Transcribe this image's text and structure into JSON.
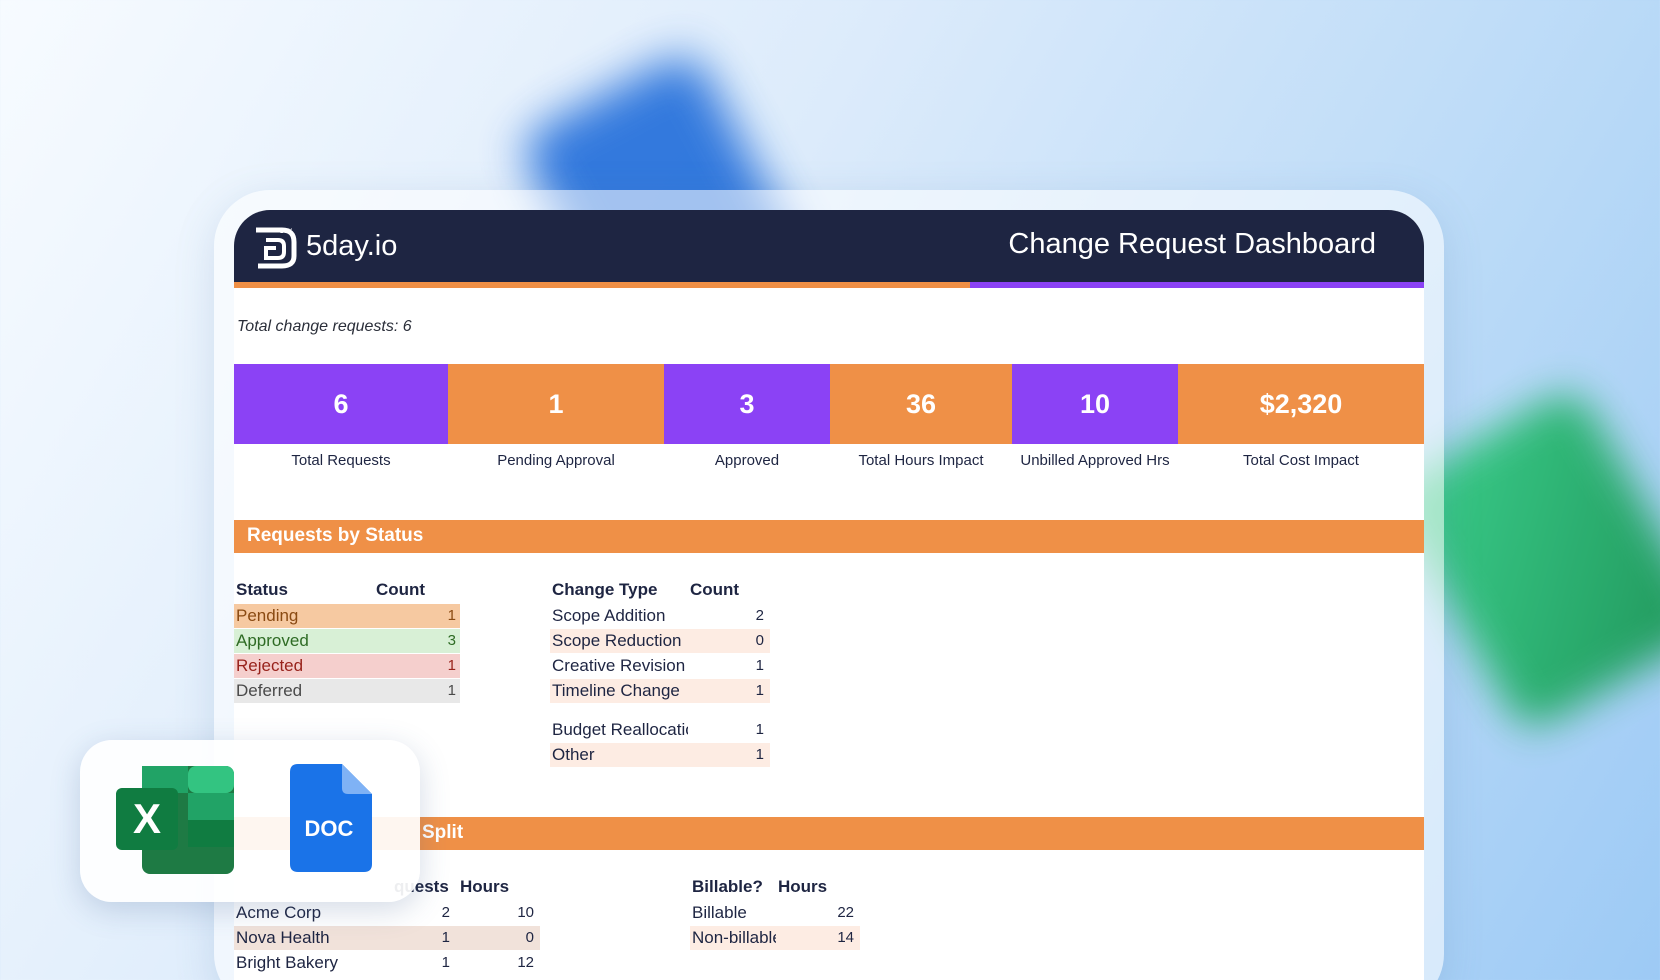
{
  "app": {
    "brand": "5day.io",
    "brand_mark_small": "DAY",
    "dashboard_title": "Change Request Dashboard",
    "total_line": "Total change requests: 6"
  },
  "kpis": [
    {
      "value": "6",
      "label": "Total Requests",
      "color": "#8b42f5"
    },
    {
      "value": "1",
      "label": "Pending Approval",
      "color": "#ef9047"
    },
    {
      "value": "3",
      "label": "Approved",
      "color": "#8b42f5"
    },
    {
      "value": "36",
      "label": "Total Hours Impact",
      "color": "#ef9047"
    },
    {
      "value": "10",
      "label": "Unbilled Approved Hrs",
      "color": "#8b42f5"
    },
    {
      "value": "$2,320",
      "label": "Total Cost Impact",
      "color": "#ef9047"
    }
  ],
  "section_status": {
    "title": "Requests by Status",
    "status_table": {
      "headers": [
        "Status",
        "Count"
      ],
      "rows": [
        {
          "label": "Pending",
          "count": "1"
        },
        {
          "label": "Approved",
          "count": "3"
        },
        {
          "label": "Rejected",
          "count": "1"
        },
        {
          "label": "Deferred",
          "count": "1"
        }
      ]
    },
    "type_table": {
      "headers": [
        "Change Type",
        "Count"
      ],
      "rows": [
        {
          "label": "Scope Addition",
          "count": "2"
        },
        {
          "label": "Scope Reduction",
          "count": "0"
        },
        {
          "label": "Creative Revision",
          "count": "1"
        },
        {
          "label": "Timeline Change",
          "count": "1"
        },
        {
          "label": "Budget Reallocation",
          "count": "1"
        },
        {
          "label": "Other",
          "count": "1"
        }
      ]
    }
  },
  "section_split": {
    "title_visible": "Split",
    "client_table": {
      "headers": [
        "quests",
        "Hours"
      ],
      "rows": [
        {
          "label": "Acme Corp",
          "requests": "2",
          "hours": "10"
        },
        {
          "label": "Nova Health",
          "requests": "1",
          "hours": "0"
        },
        {
          "label": "Bright Bakery",
          "requests": "1",
          "hours": "12"
        }
      ]
    },
    "billable_table": {
      "headers": [
        "Billable?",
        "Hours"
      ],
      "rows": [
        {
          "label": "Billable",
          "hours": "22"
        },
        {
          "label": "Non-billable",
          "hours": "14"
        }
      ]
    }
  },
  "badges": {
    "excel_letter": "X",
    "doc_label": "DOC"
  },
  "colors": {
    "navy": "#1e2542",
    "orange": "#ef9047",
    "purple": "#8b42f5"
  }
}
